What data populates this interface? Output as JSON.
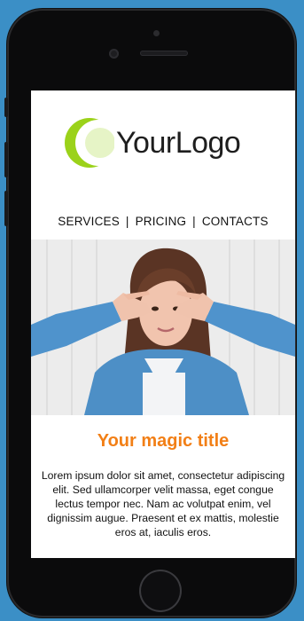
{
  "logo": {
    "text": "YourLogo",
    "icon": "crescent-moon-icon",
    "accent": "#9bd21a"
  },
  "nav": {
    "items": [
      {
        "label": "SERVICES"
      },
      {
        "label": "PRICING"
      },
      {
        "label": "CONTACTS"
      }
    ],
    "separator": "|"
  },
  "hero": {
    "icon": "hero-photo-woman"
  },
  "content": {
    "title": "Your magic title",
    "title_color": "#f27f16",
    "body": "Lorem ipsum dolor sit amet, consectetur adipiscing elit. Sed ullamcorper velit massa, eget congue lectus tempor nec. Nam ac volutpat enim, vel dignissim augue. Praesent et ex mattis, molestie eros at, iaculis eros."
  },
  "device": {
    "frame_color": "#0b0b0c",
    "background": "#3b8fc6"
  }
}
